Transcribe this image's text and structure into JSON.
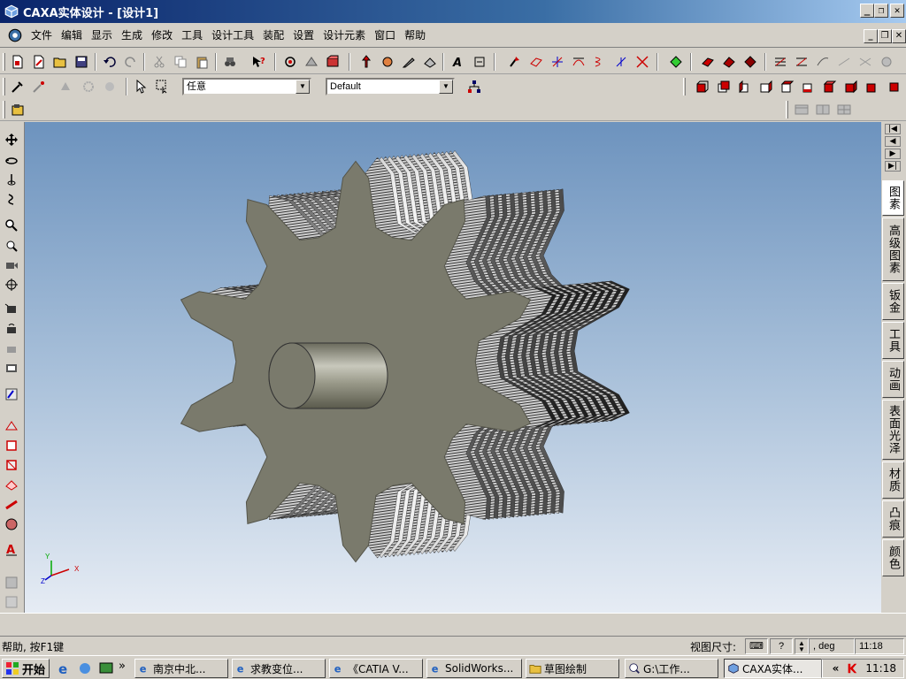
{
  "window": {
    "title": "CAXA实体设计 - [设计1]",
    "min": "_",
    "restore": "❐",
    "close": "✕"
  },
  "menu": [
    "文件",
    "编辑",
    "显示",
    "生成",
    "修改",
    "工具",
    "设计工具",
    "装配",
    "设置",
    "设计元素",
    "窗口",
    "帮助"
  ],
  "selector": {
    "mode": "任意",
    "style": "Default"
  },
  "right_tabs": [
    "图素",
    "高级图素",
    "钣金",
    "工具",
    "动画",
    "表面光泽",
    "材质",
    "凸痕",
    "颜色"
  ],
  "axes": {
    "x": "X",
    "y": "Y",
    "z": "Z"
  },
  "status": {
    "help": "帮助, 按F1键",
    "view_label": "视图尺寸:",
    "unit": "deg",
    "time": "11:18"
  },
  "taskbar": {
    "start": "开始",
    "tasks": [
      "南京中北...",
      "求教变位...",
      "《CATIA V...",
      "SolidWorks...",
      "草图绘制",
      "G:\\工作...",
      "CAXA实体..."
    ],
    "clock": "11:18",
    "chevron": "«"
  },
  "colors": {
    "title_start": "#0a246a",
    "title_end": "#a6caf0",
    "viewport_top": "#6d93be",
    "viewport_bottom": "#e6ecf4",
    "gear_face": "#7a7a6c"
  }
}
